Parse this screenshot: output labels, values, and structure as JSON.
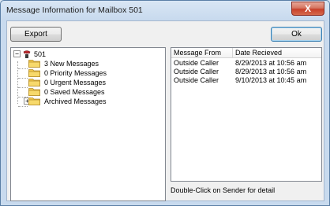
{
  "window": {
    "title": "Message Information for Mailbox 501",
    "close_symbol": "X"
  },
  "toolbar": {
    "export_label": "Export",
    "ok_label": "Ok"
  },
  "tree": {
    "root": {
      "label": "501",
      "expander": "−",
      "icon": "phone-icon"
    },
    "items": [
      {
        "label": "3 New Messages",
        "icon": "folder-icon"
      },
      {
        "label": "0 Priority Messages",
        "icon": "folder-icon"
      },
      {
        "label": "0 Urgent Messages",
        "icon": "folder-icon"
      },
      {
        "label": "0 Saved Messages",
        "icon": "folder-icon"
      },
      {
        "label": "Archived Messages",
        "icon": "folder-icon",
        "expander": "+"
      }
    ]
  },
  "messages": {
    "columns": [
      "Message From",
      "Date Recieved"
    ],
    "rows": [
      {
        "from": "Outside Caller",
        "date": "8/29/2013 at 10:56 am"
      },
      {
        "from": "Outside Caller",
        "date": "8/29/2013 at 10:56 am"
      },
      {
        "from": "Outside Caller",
        "date": "9/10/2013 at 10:45 am"
      }
    ]
  },
  "footer": {
    "hint": "Double-Click on Sender for detail"
  },
  "colors": {
    "folder": "#f2c94c",
    "phone": "#c0272d"
  }
}
